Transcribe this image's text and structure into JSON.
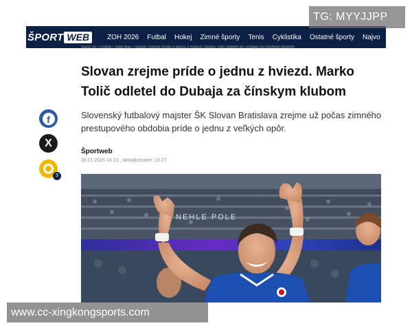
{
  "header": {
    "logo_sport": "ŠPORT",
    "logo_web": "WEB",
    "nav": [
      "ZOH 2026",
      "Futbal",
      "Hokej",
      "Zimné športy",
      "Tenis",
      "Cyklistika",
      "Ostatné športy",
      "Najvo"
    ]
  },
  "breadcrumb": "Šport.sk  ›  Futbal  ›  Niké liga  ›  Slovan zrejme príde o jednu z hviezd. Marko Tolič odletel do Dubaja za čínskym klubom",
  "article": {
    "headline": "Slovan zrejme príde o jednu z hviezd. Marko Tolič odletel do Dubaja za čínskym klubom",
    "perex": "Slovenský futbalový majster ŠK Slovan Bratislava zrejme už počas zimného prestupového obdobia príde o jednu z veľkých opôr.",
    "author": "Športweb",
    "dateline": "30.01.2026 16:13 , aktualizované: 16:27",
    "photo_banner_text": "NEHLE POLE"
  },
  "social": {
    "facebook_icon": "facebook-icon",
    "x_icon": "x-icon",
    "comments_icon": "comments-icon",
    "comment_count": "3",
    "facebook_glyph": "f",
    "x_glyph": "X"
  },
  "watermarks": {
    "top": "TG: MYYJJPP",
    "bottom": "www.cc-xingkongsports.com"
  },
  "colors": {
    "nav_bg": "#0c1f45",
    "facebook": "#2c5aa0",
    "comments": "#f0b800",
    "jersey_blue": "#1d4fb0"
  }
}
